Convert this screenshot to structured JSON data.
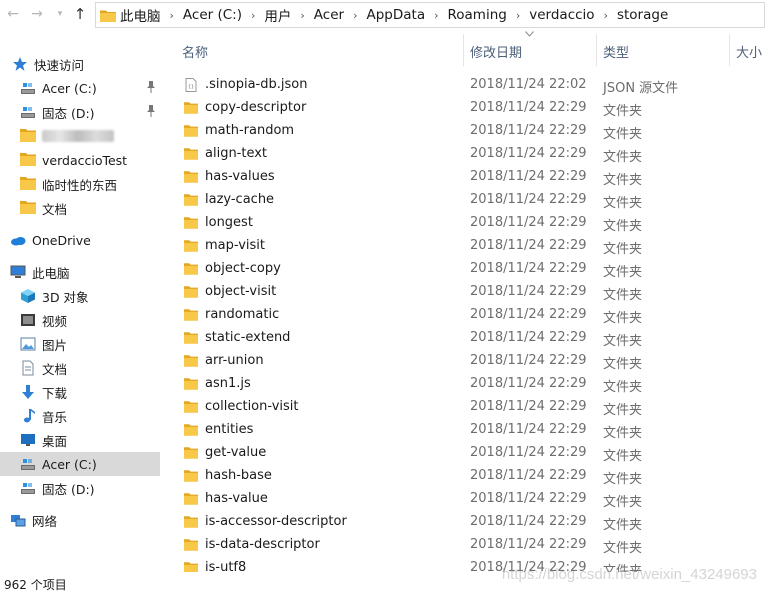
{
  "address": {
    "crumbs": [
      "此电脑",
      "Acer (C:)",
      "用户",
      "Acer",
      "AppData",
      "Roaming",
      "verdaccio",
      "storage"
    ],
    "separator": "›"
  },
  "nav": {
    "quick_access": "快速访问",
    "items": [
      {
        "label": "Acer (C:)",
        "icon": "drive-icon"
      },
      {
        "label": "固态 (D:)",
        "icon": "drive-icon"
      },
      {
        "label": "",
        "icon": "folder-icon",
        "blurred": true
      },
      {
        "label": "verdaccioTest",
        "icon": "folder-icon"
      },
      {
        "label": "临时性的东西",
        "icon": "folder-icon"
      },
      {
        "label": "文档",
        "icon": "folder-icon"
      }
    ],
    "onedrive": "OneDrive",
    "this_pc": "此电脑",
    "pc_items": [
      {
        "label": "3D 对象",
        "icon": "cube-icon"
      },
      {
        "label": "视频",
        "icon": "video-icon"
      },
      {
        "label": "图片",
        "icon": "picture-icon"
      },
      {
        "label": "文档",
        "icon": "document-icon"
      },
      {
        "label": "下载",
        "icon": "download-icon"
      },
      {
        "label": "音乐",
        "icon": "music-icon"
      },
      {
        "label": "桌面",
        "icon": "desktop-icon"
      },
      {
        "label": "Acer (C:)",
        "icon": "drive-icon",
        "selected": true
      },
      {
        "label": "固态 (D:)",
        "icon": "drive-icon"
      }
    ],
    "network": "网络"
  },
  "columns": {
    "name": "名称",
    "date": "修改日期",
    "type": "类型",
    "size": "大小"
  },
  "files": [
    {
      "name": ".sinopia-db.json",
      "date": "2018/11/24 22:02",
      "type": "JSON 源文件",
      "kind": "file"
    },
    {
      "name": "copy-descriptor",
      "date": "2018/11/24 22:29",
      "type": "文件夹",
      "kind": "folder"
    },
    {
      "name": "math-random",
      "date": "2018/11/24 22:29",
      "type": "文件夹",
      "kind": "folder"
    },
    {
      "name": "align-text",
      "date": "2018/11/24 22:29",
      "type": "文件夹",
      "kind": "folder"
    },
    {
      "name": "has-values",
      "date": "2018/11/24 22:29",
      "type": "文件夹",
      "kind": "folder"
    },
    {
      "name": "lazy-cache",
      "date": "2018/11/24 22:29",
      "type": "文件夹",
      "kind": "folder"
    },
    {
      "name": "longest",
      "date": "2018/11/24 22:29",
      "type": "文件夹",
      "kind": "folder"
    },
    {
      "name": "map-visit",
      "date": "2018/11/24 22:29",
      "type": "文件夹",
      "kind": "folder"
    },
    {
      "name": "object-copy",
      "date": "2018/11/24 22:29",
      "type": "文件夹",
      "kind": "folder"
    },
    {
      "name": "object-visit",
      "date": "2018/11/24 22:29",
      "type": "文件夹",
      "kind": "folder"
    },
    {
      "name": "randomatic",
      "date": "2018/11/24 22:29",
      "type": "文件夹",
      "kind": "folder"
    },
    {
      "name": "static-extend",
      "date": "2018/11/24 22:29",
      "type": "文件夹",
      "kind": "folder"
    },
    {
      "name": "arr-union",
      "date": "2018/11/24 22:29",
      "type": "文件夹",
      "kind": "folder"
    },
    {
      "name": "asn1.js",
      "date": "2018/11/24 22:29",
      "type": "文件夹",
      "kind": "folder"
    },
    {
      "name": "collection-visit",
      "date": "2018/11/24 22:29",
      "type": "文件夹",
      "kind": "folder"
    },
    {
      "name": "entities",
      "date": "2018/11/24 22:29",
      "type": "文件夹",
      "kind": "folder"
    },
    {
      "name": "get-value",
      "date": "2018/11/24 22:29",
      "type": "文件夹",
      "kind": "folder"
    },
    {
      "name": "hash-base",
      "date": "2018/11/24 22:29",
      "type": "文件夹",
      "kind": "folder"
    },
    {
      "name": "has-value",
      "date": "2018/11/24 22:29",
      "type": "文件夹",
      "kind": "folder"
    },
    {
      "name": "is-accessor-descriptor",
      "date": "2018/11/24 22:29",
      "type": "文件夹",
      "kind": "folder"
    },
    {
      "name": "is-data-descriptor",
      "date": "2018/11/24 22:29",
      "type": "文件夹",
      "kind": "folder"
    },
    {
      "name": "is-utf8",
      "date": "2018/11/24 22:29",
      "type": "文件夹",
      "kind": "folder"
    }
  ],
  "status": {
    "count_text": "962 个项目"
  },
  "watermark": "https://blog.csdn.net/weixin_43249693",
  "colors": {
    "folder": "#f8c848",
    "folder_dark": "#e3a71f",
    "header_text": "#4c607a",
    "selected_bg": "#d9d9d9"
  }
}
